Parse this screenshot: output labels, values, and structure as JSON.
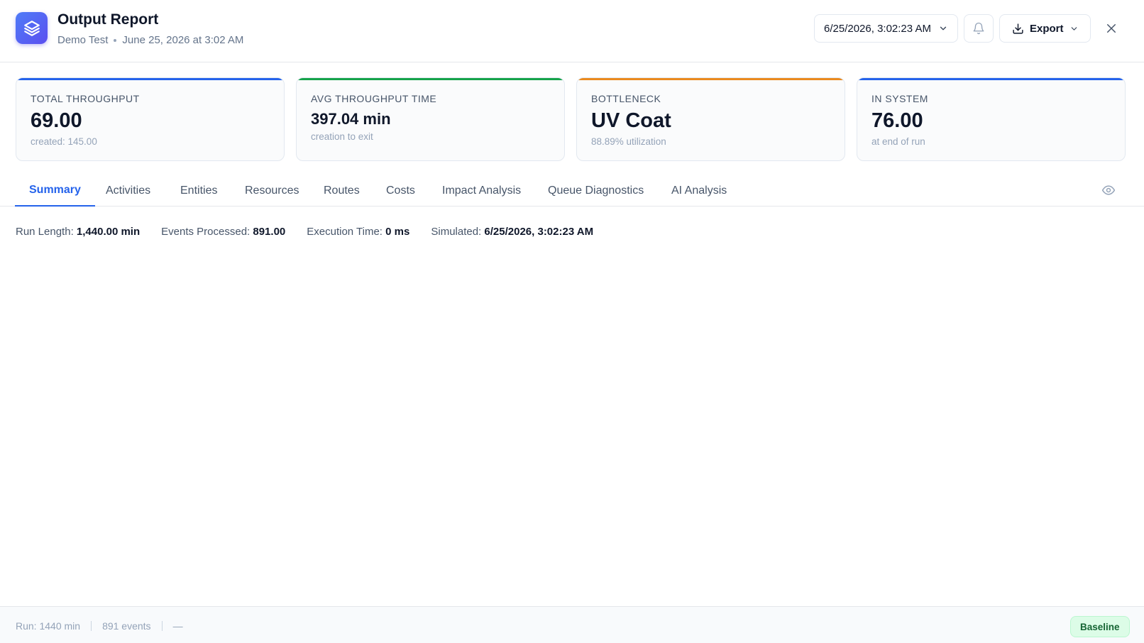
{
  "header": {
    "title": "Output Report",
    "project": "Demo Test",
    "date_text": "June 25, 2026 at 3:02 AM",
    "run_selector": "6/25/2026, 3:02:23 AM",
    "export_label": "Export",
    "icons": {
      "app": "layers-icon",
      "run_selector": "chevron-down-icon",
      "notifications": "bell-icon",
      "export": "download-icon",
      "close": "close-icon"
    }
  },
  "kpis": [
    {
      "label": "TOTAL THROUGHPUT",
      "value": "69.00",
      "sub": "created: 145.00",
      "color": "#2563eb"
    },
    {
      "label": "AVG THROUGHPUT TIME",
      "value": "397.04 min",
      "sub": "creation to exit",
      "color": "#16a34a"
    },
    {
      "label": "BOTTLENECK",
      "value": "UV Coat",
      "sub": "88.89% utilization",
      "color": "#ea8a1f"
    },
    {
      "label": "IN SYSTEM",
      "value": "76.00",
      "sub": "at end of run",
      "color": "#2563eb"
    }
  ],
  "tabs": [
    {
      "label": "Summary",
      "active": true
    },
    {
      "label": "Activities"
    },
    {
      "label": "Entities"
    },
    {
      "label": "Resources"
    },
    {
      "label": "Routes"
    },
    {
      "label": "Costs"
    },
    {
      "label": "Impact Analysis"
    },
    {
      "label": "Queue Diagnostics"
    },
    {
      "label": "AI Analysis"
    }
  ],
  "summary": {
    "run_length_label": "Run Length:",
    "run_length": "1,440.00 min",
    "events_label": "Events Processed:",
    "events": "891.00",
    "exec_label": "Execution Time:",
    "exec": "0 ms",
    "simulated_label": "Simulated:",
    "simulated": "6/25/2026, 3:02:23 AM"
  },
  "footer": {
    "run": "Run: 1440 min",
    "events": "891 events",
    "extra": "—",
    "badge": "Baseline"
  },
  "colors": {
    "accent": "#2563eb",
    "badge_bg": "#dcfce7",
    "badge_text": "#166534"
  }
}
